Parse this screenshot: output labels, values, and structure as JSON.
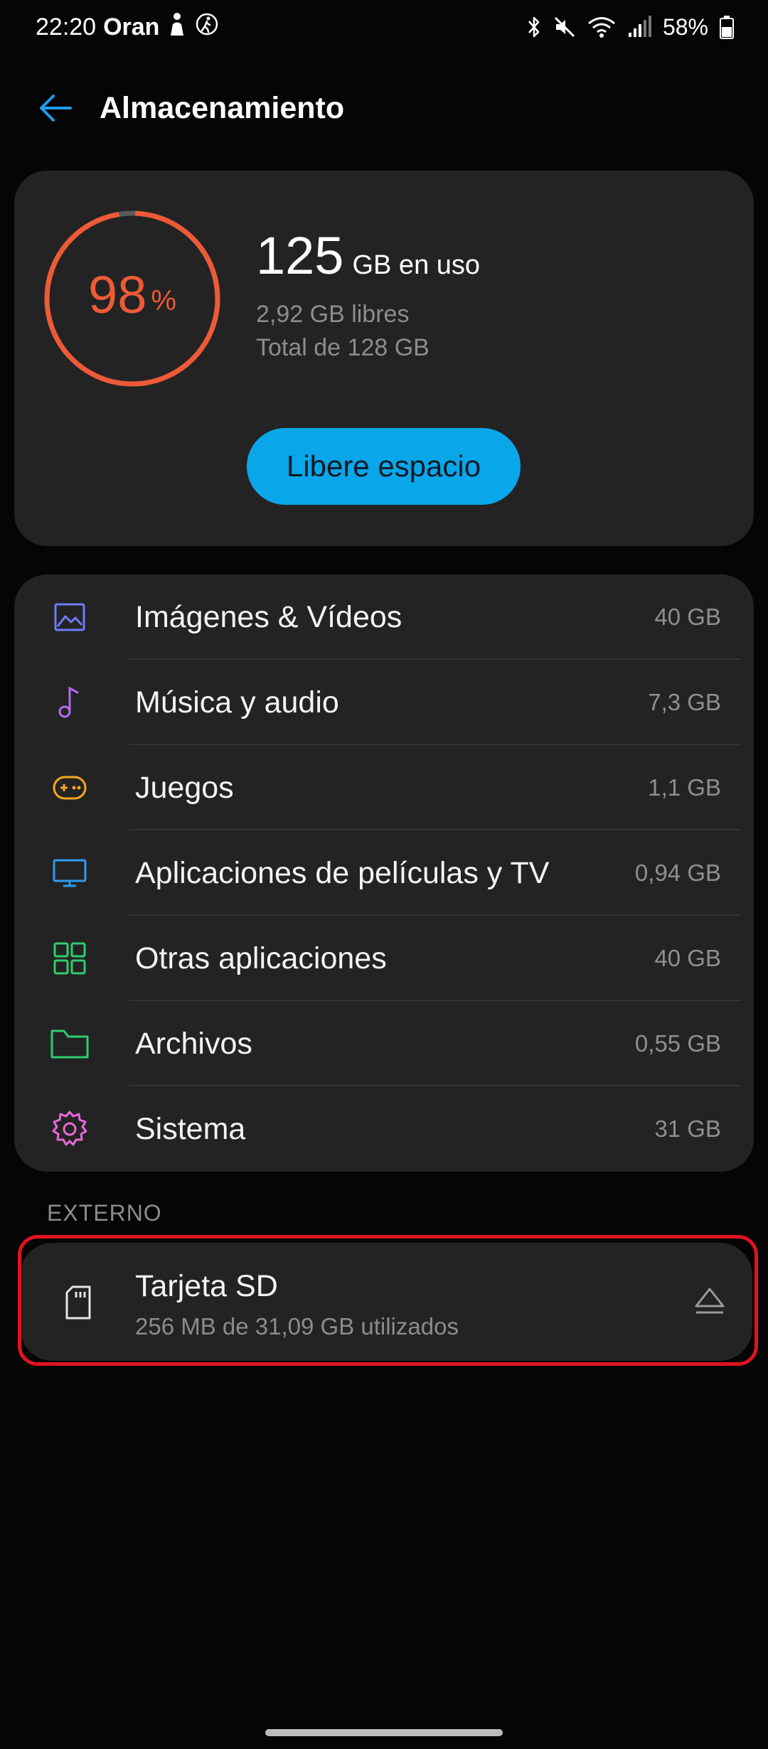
{
  "status_bar": {
    "time": "22:20",
    "carrier": "Oran",
    "battery": "58%"
  },
  "app_bar": {
    "title": "Almacenamiento",
    "back_icon": "arrow-left-icon"
  },
  "summary": {
    "percent": "98",
    "percent_unit": "%",
    "percent_fraction": 0.98,
    "used_amount": "125",
    "used_suffix": "GB en uso",
    "free_text": "2,92 GB libres",
    "total_text": "Total de 128 GB",
    "free_button_label": "Libere espacio",
    "colors": {
      "ring": "#ee5a37",
      "ring_remaining": "#5a5a5a",
      "button": "#0aa6ea"
    }
  },
  "categories": [
    {
      "label": "Imágenes & Vídeos",
      "size": "40 GB",
      "icon": "image-icon",
      "color": "#6f7bf7"
    },
    {
      "label": "Música y audio",
      "size": "7,3 GB",
      "icon": "music-note-icon",
      "color": "#b06cf2"
    },
    {
      "label": "Juegos",
      "size": "1,1 GB",
      "icon": "gamepad-icon",
      "color": "#f5a623"
    },
    {
      "label": "Aplicaciones de películas y TV",
      "size": "0,94 GB",
      "icon": "tv-icon",
      "color": "#2d9cf0"
    },
    {
      "label": "Otras aplicaciones",
      "size": "40 GB",
      "icon": "apps-grid-icon",
      "color": "#2ecc71"
    },
    {
      "label": "Archivos",
      "size": "0,55 GB",
      "icon": "folder-icon",
      "color": "#2ecc71"
    },
    {
      "label": "Sistema",
      "size": "31 GB",
      "icon": "gear-icon",
      "color": "#e86ad8"
    }
  ],
  "external": {
    "header": "EXTERNO",
    "sd_title": "Tarjeta SD",
    "sd_subtitle": "256 MB de 31,09 GB utilizados",
    "sd_icon": "sd-card-icon",
    "eject_icon": "eject-icon",
    "highlight_color": "#e01320"
  }
}
